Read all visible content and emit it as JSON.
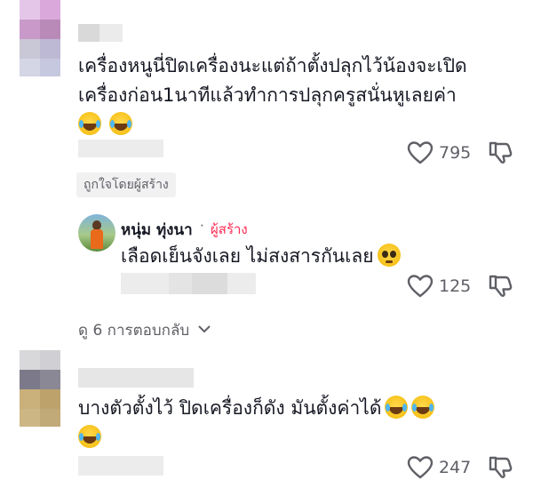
{
  "comments": [
    {
      "text": "เครื่องหนูนี่ปิดเครื่องนะแต่ถ้าตั้งปลุกไว้น้องจะเปิดเครื่องก่อน1นาทีแล้วทำการปลุกครูสนั่นหูเลยค่า",
      "line1": "เครื่องหนูนี่ปิดเครื่องนะแต่ถ้าตั้งปลุกไว้น้องจะเปิด",
      "line2": "เครื่องก่อน1นาทีแล้วทำการปลุกครูสนั่นหูเลยค่า",
      "likes": "795",
      "badge": "ถูกใจโดยผู้สร้าง",
      "emoji": [
        "face-with-tears-of-joy",
        "face-with-tears-of-joy"
      ]
    },
    {
      "author": "หนุ่ม ทุ่งนา",
      "separator": "·",
      "role": "ผู้สร้าง",
      "text": "เลือดเย็นจังเลย ไม่สงสารกันเลย",
      "likes": "125",
      "emoji": [
        "pleading-face"
      ]
    },
    {
      "text": "บางตัวตั้งไว้ ปิดเครื่องก็ดัง มันตั้งค่าได้",
      "likes": "247",
      "emoji": [
        "face-with-tears-of-joy",
        "face-with-tears-of-joy",
        "face-with-tears-of-joy"
      ]
    }
  ],
  "view_replies": {
    "label": "ดู 6 การตอบกลับ",
    "icon": "chevron-down-icon"
  },
  "colors": {
    "text": "#161823",
    "muted": "#5f6066",
    "creator": "#fe2c55",
    "badge_bg": "#f1f1f2"
  }
}
